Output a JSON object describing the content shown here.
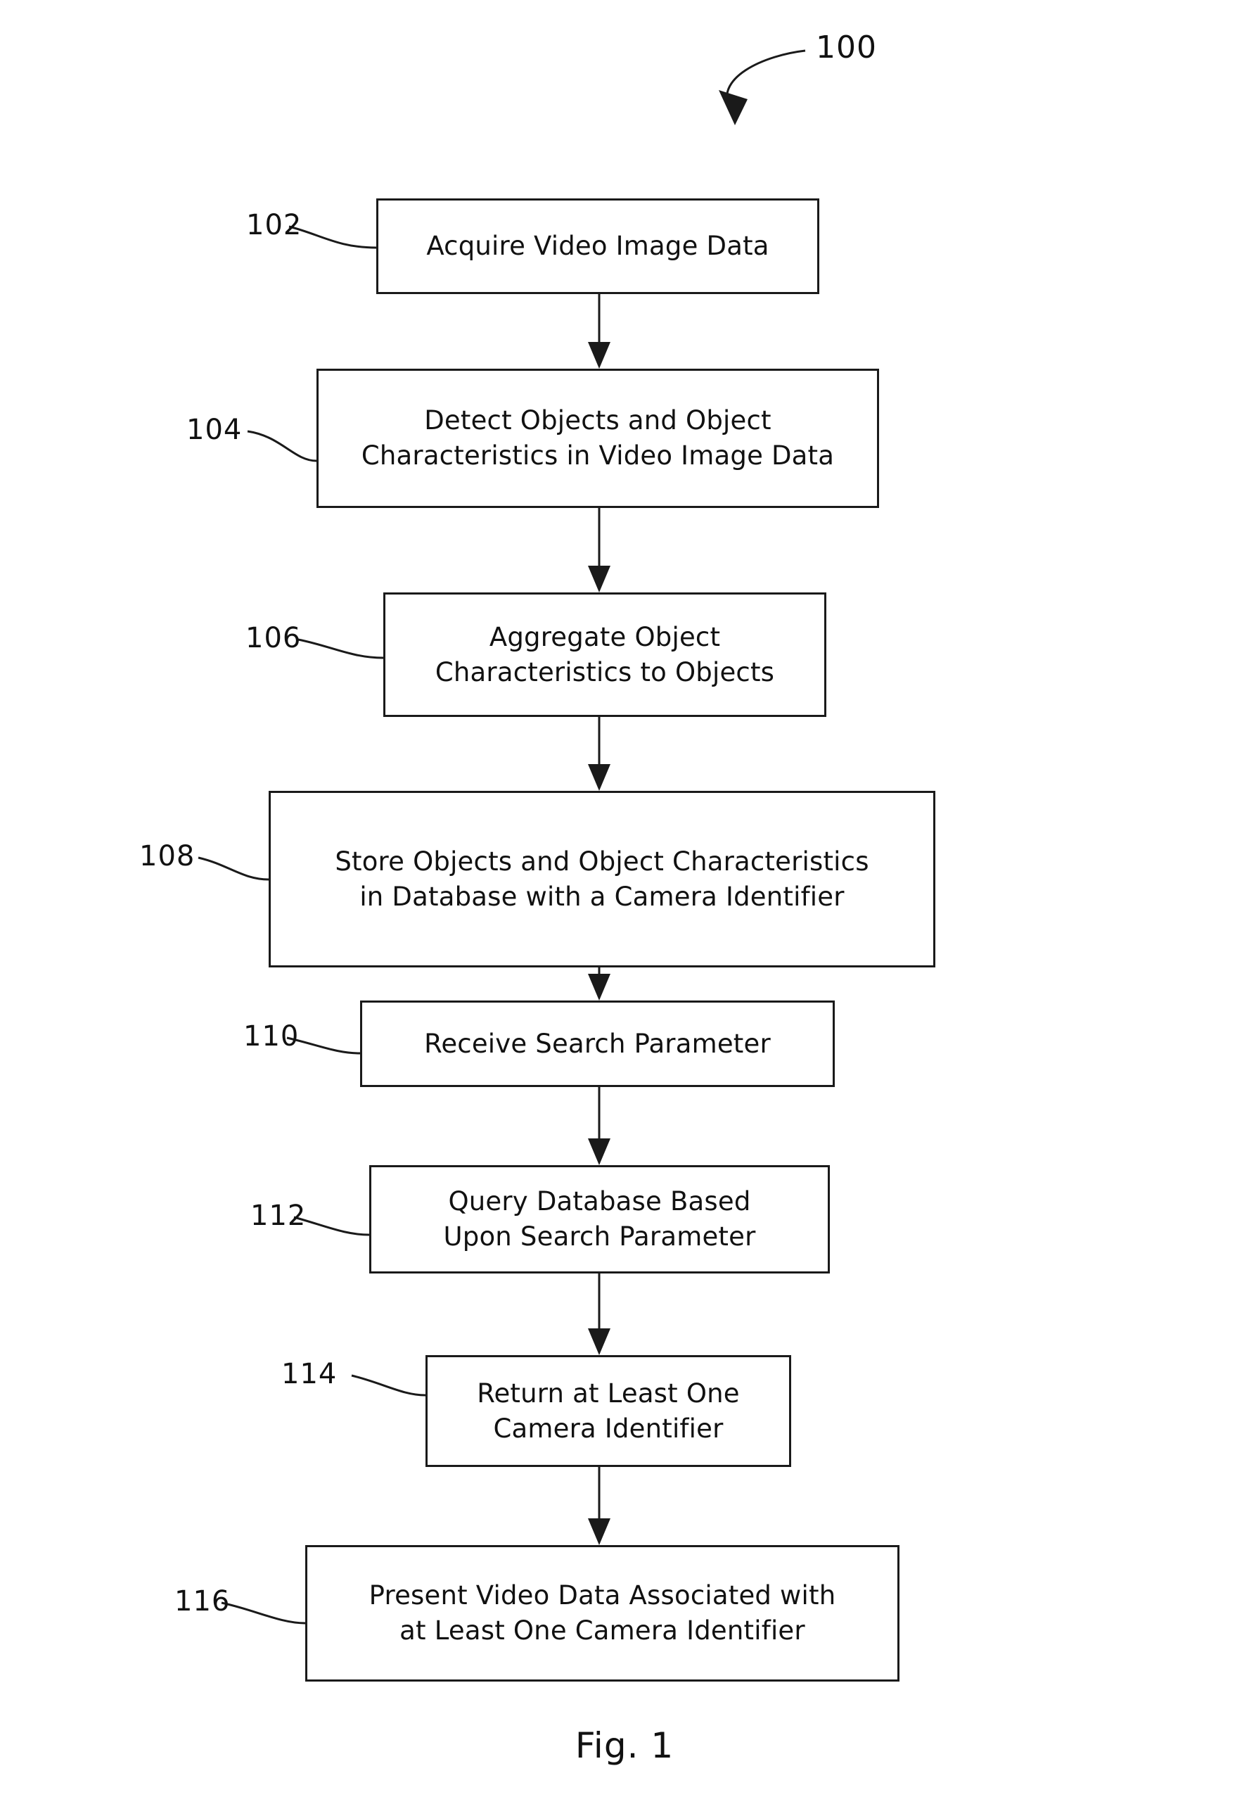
{
  "figure": {
    "caption": "Fig. 1",
    "diagram_ref": "100"
  },
  "nodes": [
    {
      "ref": "102",
      "label": "Acquire Video Image Data",
      "name": "acquire-video-image-data"
    },
    {
      "ref": "104",
      "label": "Detect Objects and Object\nCharacteristics in Video Image Data",
      "name": "detect-objects-and-characteristics"
    },
    {
      "ref": "106",
      "label": "Aggregate Object\nCharacteristics to Objects",
      "name": "aggregate-object-characteristics"
    },
    {
      "ref": "108",
      "label": "Store Objects and Object Characteristics\nin Database with a Camera Identifier",
      "name": "store-objects-in-database"
    },
    {
      "ref": "110",
      "label": "Receive Search Parameter",
      "name": "receive-search-parameter"
    },
    {
      "ref": "112",
      "label": "Query Database Based\nUpon Search Parameter",
      "name": "query-database"
    },
    {
      "ref": "114",
      "label": "Return at Least One\nCamera Identifier",
      "name": "return-camera-identifier"
    },
    {
      "ref": "116",
      "label": "Present Video Data Associated with\nat Least One Camera Identifier",
      "name": "present-video-data"
    }
  ],
  "colors": {
    "ink": "#1a1a1a",
    "paper": "#ffffff"
  }
}
